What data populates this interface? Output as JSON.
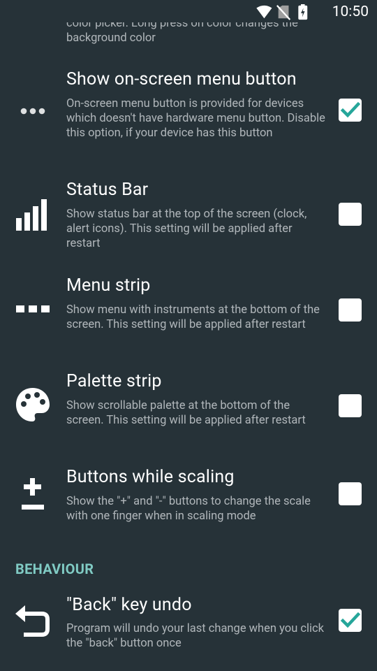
{
  "status": {
    "time": "10:50"
  },
  "partial": {
    "desc": "color picker. Long press on color changes the background color"
  },
  "rows": [
    {
      "title": "Show on-screen menu button",
      "desc": "On-screen menu button is provided for devices which doesn't have hardware menu button. Disable this option, if your device has this button",
      "checked": true,
      "icon": "more-horizontal-icon"
    },
    {
      "title": "Status Bar",
      "desc": "Show status bar at the top of the screen (clock, alert icons). This setting will be applied after restart",
      "checked": false,
      "icon": "signal-bars-icon"
    },
    {
      "title": "Menu strip",
      "desc": "Show menu with instruments at the bottom of the screen. This setting will be applied after restart",
      "checked": false,
      "icon": "menu-strip-icon"
    },
    {
      "title": "Palette strip",
      "desc": "Show scrollable palette at the bottom of the screen. This setting will be applied after restart",
      "checked": false,
      "icon": "palette-icon"
    },
    {
      "title": "Buttons while scaling",
      "desc": "Show the \"+\" and \"-\" buttons to change the scale with one finger when in scaling mode",
      "checked": false,
      "icon": "plus-minus-icon"
    }
  ],
  "section": {
    "header": "BEHAVIOUR"
  },
  "back_row": {
    "title": "\"Back\" key undo",
    "desc": "Program will undo your last change when you click the \"back\" button once",
    "checked": true,
    "icon": "undo-icon"
  },
  "colors": {
    "background": "#263238",
    "accent": "#80cbc4",
    "check": "#26a69a"
  }
}
